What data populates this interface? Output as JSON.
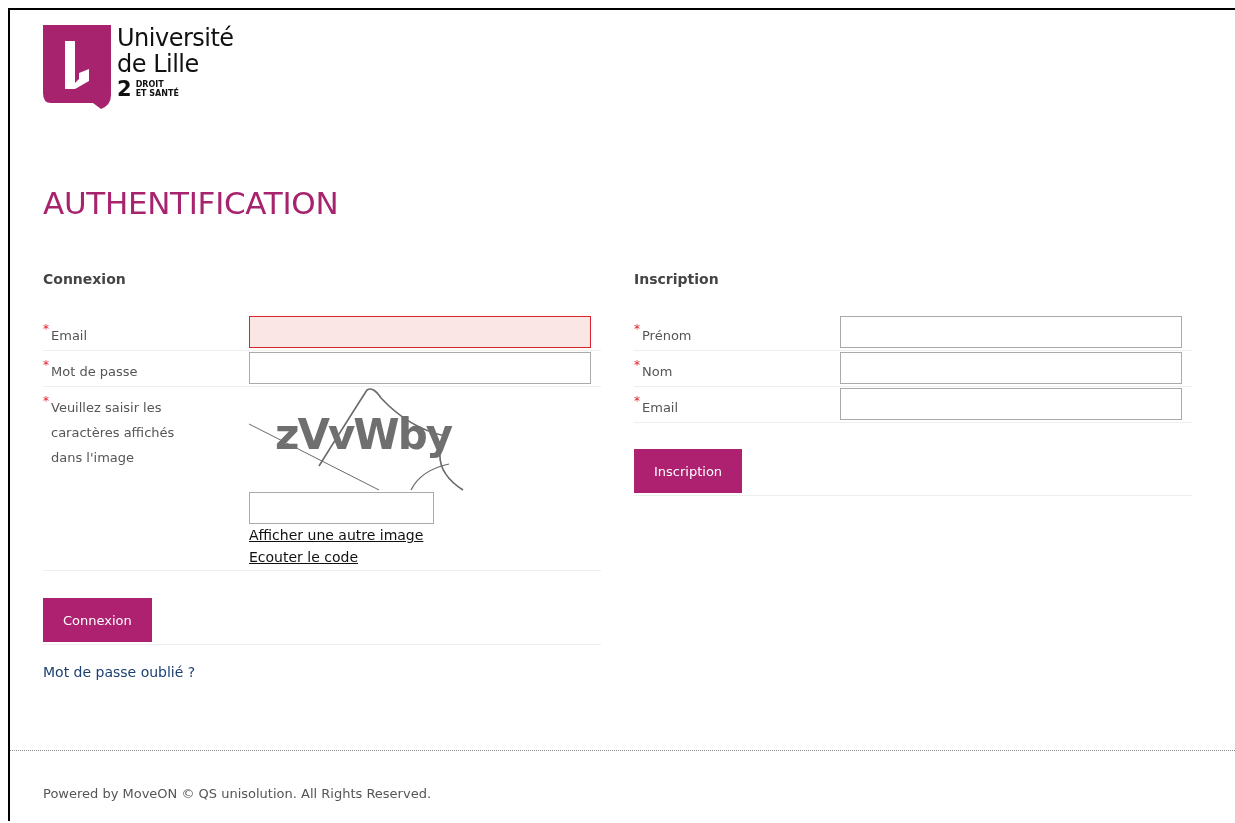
{
  "logo": {
    "line_1": "Université",
    "line_2": "de Lille",
    "number": "2",
    "line_3": "DROIT",
    "line_4": "ET SANTÉ"
  },
  "heading": "AUTHENTIFICATION",
  "connexion": {
    "title": "Connexion",
    "fields": [
      {
        "kind": "input",
        "required_mark": "*",
        "label": "Email",
        "invalid": true
      },
      {
        "kind": "input",
        "required_mark": "*",
        "label": "Mot de passe",
        "invalid": false
      },
      {
        "kind": "captcha",
        "required_mark": "*",
        "label": "Veuillez saisir les caractères affichés dans l'image",
        "invalid": false,
        "captcha_text": "zVvWby",
        "links": [
          "Afficher une autre image",
          "Ecouter le code"
        ]
      }
    ],
    "button": "Connexion",
    "forgot_link": "Mot de passe oublié ?"
  },
  "inscription": {
    "title": "Inscription",
    "fields": [
      {
        "kind": "input",
        "required_mark": "*",
        "label": "Prénom",
        "invalid": false
      },
      {
        "kind": "input",
        "required_mark": "*",
        "label": "Nom",
        "invalid": false
      },
      {
        "kind": "input",
        "required_mark": "*",
        "label": "Email",
        "invalid": false
      }
    ],
    "button": "Inscription"
  },
  "footer": "Powered by MoveON © QS unisolution. All Rights Reserved."
}
